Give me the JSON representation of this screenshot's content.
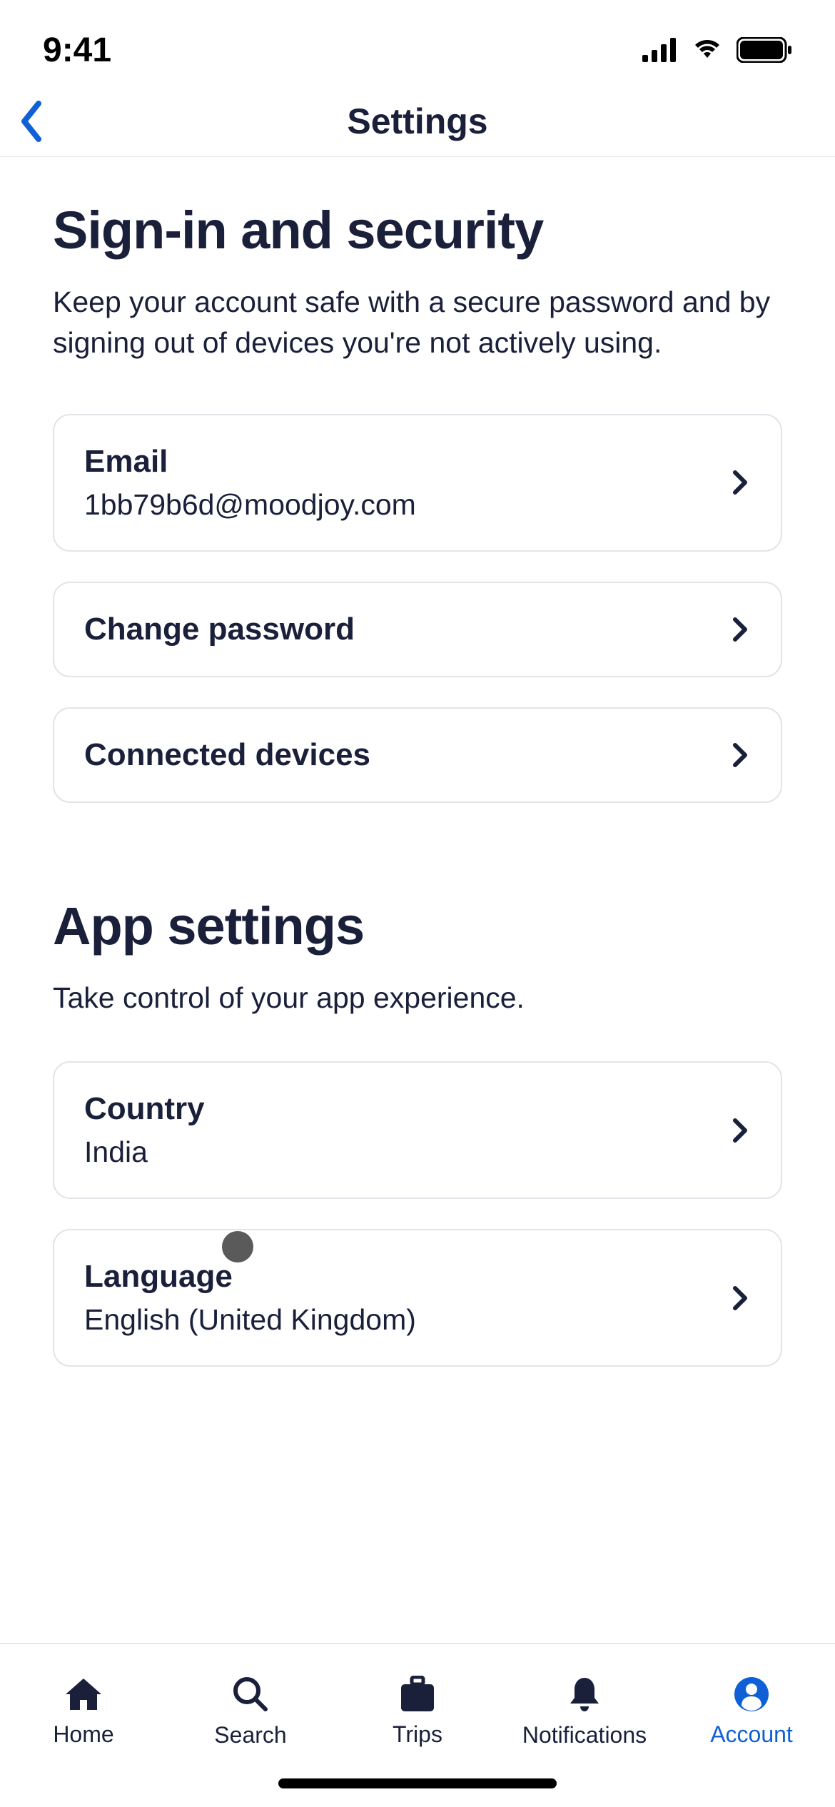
{
  "statusBar": {
    "time": "9:41"
  },
  "nav": {
    "title": "Settings"
  },
  "sections": [
    {
      "title": "Sign-in and security",
      "description": "Keep your account safe with a secure password and by signing out of devices you're not actively using.",
      "items": [
        {
          "label": "Email",
          "value": "1bb79b6d@moodjoy.com"
        },
        {
          "label": "Change password",
          "value": null
        },
        {
          "label": "Connected devices",
          "value": null
        }
      ]
    },
    {
      "title": "App settings",
      "description": "Take control of your app experience.",
      "items": [
        {
          "label": "Country",
          "value": "India"
        },
        {
          "label": "Language",
          "value": "English (United Kingdom)"
        }
      ]
    }
  ],
  "tabs": [
    {
      "label": "Home",
      "icon": "home"
    },
    {
      "label": "Search",
      "icon": "search"
    },
    {
      "label": "Trips",
      "icon": "suitcase"
    },
    {
      "label": "Notifications",
      "icon": "bell"
    },
    {
      "label": "Account",
      "icon": "person"
    }
  ],
  "activeTab": 4,
  "colors": {
    "primary": "#0f5fd6",
    "text": "#1a1f3a",
    "border": "#e2e4e9"
  }
}
